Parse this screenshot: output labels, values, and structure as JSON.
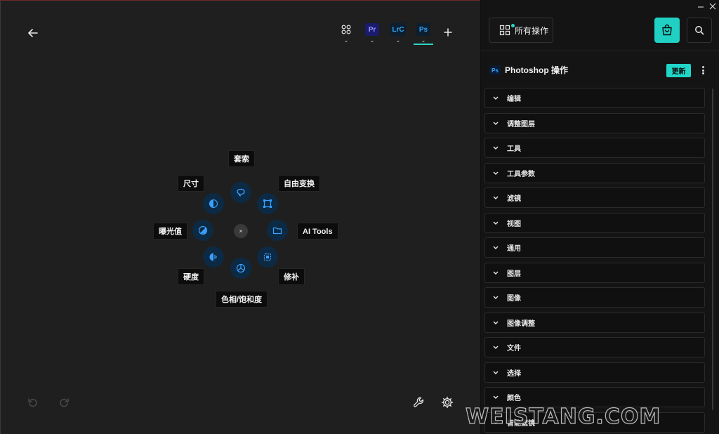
{
  "header": {
    "back_icon": "arrow-left-icon",
    "apps": [
      {
        "label": "",
        "icon": "grid-apps-icon",
        "color": "#ffffff"
      },
      {
        "label": "Pr",
        "icon": "premiere-icon",
        "color": "#9999ff",
        "bg": "#1b1b6e"
      },
      {
        "label": "LrC",
        "icon": "lightroom-classic-icon",
        "color": "#31a8ff",
        "bg": "#001e36"
      },
      {
        "label": "Ps",
        "icon": "photoshop-icon",
        "color": "#31a8ff",
        "bg": "#001e36",
        "active": true
      }
    ],
    "add_icon": "plus-icon"
  },
  "radial": {
    "center_icon": "close-icon",
    "labels": {
      "top": "套索",
      "top_right": "自由变换",
      "top_left": "尺寸",
      "right": "AI Tools",
      "left": "曝光值",
      "bottom_left": "硬度",
      "bottom_right": "修补",
      "bottom": "色相/饱和度"
    }
  },
  "footer_left": {
    "undo_icon": "undo-icon",
    "redo_icon": "redo-icon",
    "wrench_icon": "wrench-icon",
    "settings_icon": "gear-icon"
  },
  "toolbar": {
    "all_ops_label": "所有操作",
    "store_icon": "shopping-bag-icon",
    "search_icon": "search-icon"
  },
  "panel": {
    "badge": "Ps",
    "title": "Photoshop 操作",
    "update_label": "更新",
    "categories": [
      "编辑",
      "调整图层",
      "工具",
      "工具参数",
      "滤镜",
      "视图",
      "通用",
      "图层",
      "图像",
      "图像调整",
      "文件",
      "选择",
      "颜色",
      "智能滤镜"
    ]
  },
  "colors": {
    "accent": "#20d6c8",
    "radial_button": "#0d2a44",
    "radial_icon": "#3aa0ff"
  },
  "watermark": "WEISTANG.COM"
}
